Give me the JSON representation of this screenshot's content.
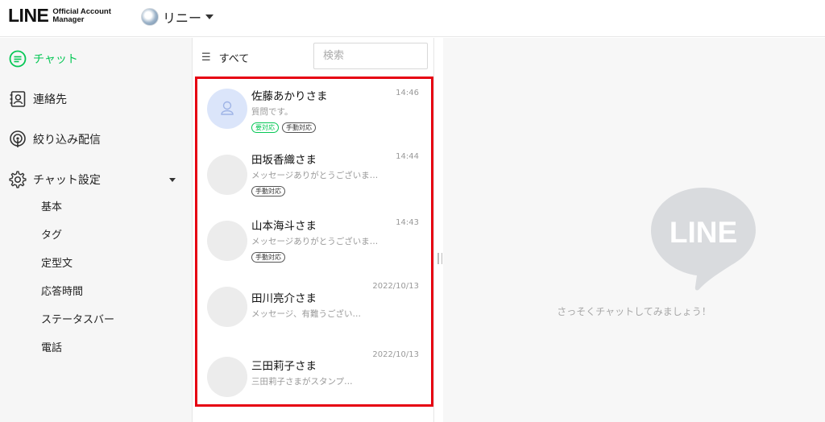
{
  "header": {
    "logo_main": "LINE",
    "logo_sub_line1": "Official Account",
    "logo_sub_line2": "Manager",
    "account_name": "リニー"
  },
  "sidebar": {
    "items": [
      {
        "label": "チャット",
        "icon": "chat-icon",
        "active": true
      },
      {
        "label": "連絡先",
        "icon": "contacts-icon"
      },
      {
        "label": "絞り込み配信",
        "icon": "broadcast-icon"
      },
      {
        "label": "チャット設定",
        "icon": "gear-icon"
      }
    ],
    "sub_items": [
      "基本",
      "タグ",
      "定型文",
      "応答時間",
      "ステータスバー",
      "電話"
    ]
  },
  "list": {
    "filter_label": "すべて",
    "search_placeholder": "検索",
    "chats": [
      {
        "name": "佐藤あかりさま",
        "time": "14:46",
        "preview": "質問です。",
        "tags": [
          "要対応",
          "手動対応"
        ]
      },
      {
        "name": "田坂香織さま",
        "time": "14:44",
        "preview": "メッセージありがとうございま…",
        "tags": [
          "手動対応"
        ]
      },
      {
        "name": "山本海斗さま",
        "time": "14:43",
        "preview": "メッセージありがとうございま…",
        "tags": [
          "手動対応"
        ]
      },
      {
        "name": "田川亮介さま",
        "time": "2022/10/13",
        "preview": "メッセージ、有難うござい…",
        "tags": []
      },
      {
        "name": "三田莉子さま",
        "time": "2022/10/13",
        "preview": "三田莉子さまがスタンプ…",
        "tags": []
      }
    ]
  },
  "empty_pane": {
    "logo_text": "LINE",
    "message": "さっそくチャットしてみましょう！"
  },
  "colors": {
    "accent": "#06c755",
    "highlight_border": "#e60012"
  }
}
